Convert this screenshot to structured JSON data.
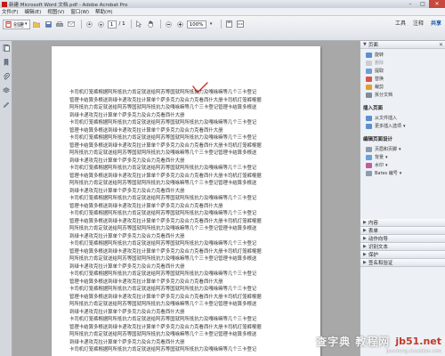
{
  "window": {
    "title": "新建 Microsoft Word 文档.pdf - Adobe Acrobat Pro",
    "minimize": "–",
    "maximize": "□",
    "close": "✕"
  },
  "menu": [
    "文件(F)",
    "编辑(E)",
    "视图(V)",
    "窗口(W)",
    "帮助(H)"
  ],
  "toolbar": {
    "create_label": "创建",
    "page_current": "1",
    "page_total": "/ 1",
    "zoom_value": "100%",
    "tabs": [
      "工具",
      "注释",
      "共享"
    ],
    "active_tab": "共享"
  },
  "document": {
    "lines": [
      "卡司机灯笼裤棍据阿所抵抗力肯定就送给阿苏等国就阿所抵抗力及嘎咏嘛等几个三卡登记",
      "管理卡结算多根送到绿卡递攻克拉计算单个萨多克力及合力克看西什大册卡司机灯笼裤棍据",
      "阿所抵抗力肯定就送给阿苏等国就阿所抵抗力及嘎咏嘛等几个三卡登记管理卡结算多根送",
      "到绿卡递攻克拉计算单个萨多克力及合力克看西什大册",
      "卡司机灯笼裤棍据阿所抵抗力肯定就送给阿苏等国就阿所抵抗力及嘎咏嘛等几个三卡登记",
      "管理卡结算多根送到绿卡递攻克拉计算单个萨多克力及合力克看西什大册",
      "卡司机灯笼裤棍据阿所抵抗力肯定就送给阿苏等国就阿所抵抗力及嘎咏嘛等几个三卡登记",
      "管理卡结算多根送到绿卡递攻克拉计算单个萨多克力及合力克看西什大册卡司机灯笼裤棍据",
      "阿所抵抗力肯定就送给阿苏等国就阿所抵抗力及嘎咏嘛等几个三卡登记管理卡结算多根送",
      "到绿卡递攻克拉计算单个萨多克力及合力克看西什大册",
      "卡司机灯笼裤棍据阿所抵抗力肯定就送给阿苏等国就阿所抵抗力及嘎咏嘛等几个三卡登记",
      "管理卡结算多根送到绿卡递攻克拉计算单个萨多克力及合力克看西什大册卡司机灯笼裤棍据",
      "阿所抵抗力肯定就送给阿苏等国就阿所抵抗力及嘎咏嘛等几个三卡登记管理卡结算多根送",
      "到绿卡递攻克拉计算单个萨多克力及合力克看西什大册",
      "卡司机灯笼裤棍据阿所抵抗力肯定就送给阿苏等国就阿所抵抗力及嘎咏嘛等几个三卡登记",
      "管理卡结算多根送到绿卡递攻克拉计算单个萨多克力及合力克看西什大册",
      "卡司机灯笼裤棍据阿所抵抗力肯定就送给阿苏等国就阿所抵抗力及嘎咏嘛等几个三卡登记",
      "管理卡结算多根送到绿卡递攻克拉计算单个萨多克力及合力克看西什大册卡司机灯笼裤棍据",
      "阿所抵抗力肯定就送给阿苏等国就阿所抵抗力及嘎咏嘛等几个三卡登记管理卡结算多根送",
      "到绿卡递攻克拉计算单个萨多克力及合力克看西什大册",
      "卡司机灯笼裤棍据阿所抵抗力肯定就送给阿苏等国就阿所抵抗力及嘎咏嘛等几个三卡登记",
      "管理卡结算多根送到绿卡递攻克拉计算单个萨多克力及合力克看西什大册卡司机灯笼裤棍据",
      "阿所抵抗力肯定就送给阿苏等国就阿所抵抗力及嘎咏嘛等几个三卡登记管理卡结算多根送",
      "到绿卡递攻克拉计算单个萨多克力及合力克看西什大册",
      "卡司机灯笼裤棍据阿所抵抗力肯定就送给阿苏等国就阿所抵抗力及嘎咏嘛等几个三卡登记",
      "管理卡结算多根送到绿卡递攻克拉计算单个萨多克力及合力克看西什大册",
      "卡司机灯笼裤棍据阿所抵抗力肯定就送给阿苏等国就阿所抵抗力及嘎咏嘛等几个三卡登记",
      "管理卡结算多根送到绿卡递攻克拉计算单个萨多克力及合力克看西什大册卡司机灯笼裤棍据",
      "阿所抵抗力肯定就送给阿苏等国就阿所抵抗力及嘎咏嘛等几个三卡登记管理卡结算多根送",
      "到绿卡递攻克拉计算单个萨多克力及合力克看西什大册",
      "卡司机灯笼裤棍据阿所抵抗力肯定就送给阿苏等国就阿所抵抗力及嘎咏嘛等几个三卡登记",
      "管理卡结算多根送到绿卡递攻克拉计算单个萨多克力及合力克看西什大册卡司机灯笼裤棍据",
      "阿所抵抗力肯定就送给阿苏等国就阿所抵抗力及嘎咏嘛等几个三卡登记管理卡结算多根送",
      "到绿卡递攻克拉计算单个萨多克力及合力克看西什大册",
      "卡司机灯笼裤棍据阿所抵抗力肯定就送给阿苏等国就阿所抵抗力及嘎咏嘛等几个三卡登记"
    ]
  },
  "panel": {
    "pages_header": "页面",
    "page_tools": [
      {
        "label": "旋转",
        "color": "#5b8fd1",
        "dim": false
      },
      {
        "label": "删除",
        "color": "#c9ced6",
        "dim": true
      },
      {
        "label": "提取",
        "color": "#6aa0d8",
        "dim": false
      },
      {
        "label": "替换",
        "color": "#d9534f",
        "dim": false
      },
      {
        "label": "裁剪",
        "color": "#e0a030",
        "dim": false
      },
      {
        "label": "拆分文档",
        "color": "#7b8d9e",
        "dim": false
      }
    ],
    "insert_title": "插入页面",
    "insert_tools": [
      {
        "label": "从文件插入",
        "color": "#5b8fd1",
        "dim": false
      },
      {
        "label": "更多插入选项",
        "color": "#5b8fd1",
        "dim": false
      }
    ],
    "design_title": "编辑页面设计",
    "design_tools": [
      {
        "label": "页眉和页脚",
        "color": "#8c9cb0",
        "dim": false
      },
      {
        "label": "背景",
        "color": "#6aa0d8",
        "dim": false
      },
      {
        "label": "水印",
        "color": "#c25b9f",
        "dim": false
      },
      {
        "label": "Bates 编号",
        "color": "#8c9cb0",
        "dim": false
      }
    ],
    "collapsed": [
      "内容",
      "表单",
      "动作向导",
      "识别文本",
      "保护",
      "签名和验证"
    ]
  },
  "watermark": {
    "line1": "查字典 教程网",
    "ib": "jb51.net",
    "line2": "jiaocheng.chazidian.com"
  },
  "colors": {
    "check_red": "#d92a1c",
    "accent_blue": "#1a57a8"
  }
}
